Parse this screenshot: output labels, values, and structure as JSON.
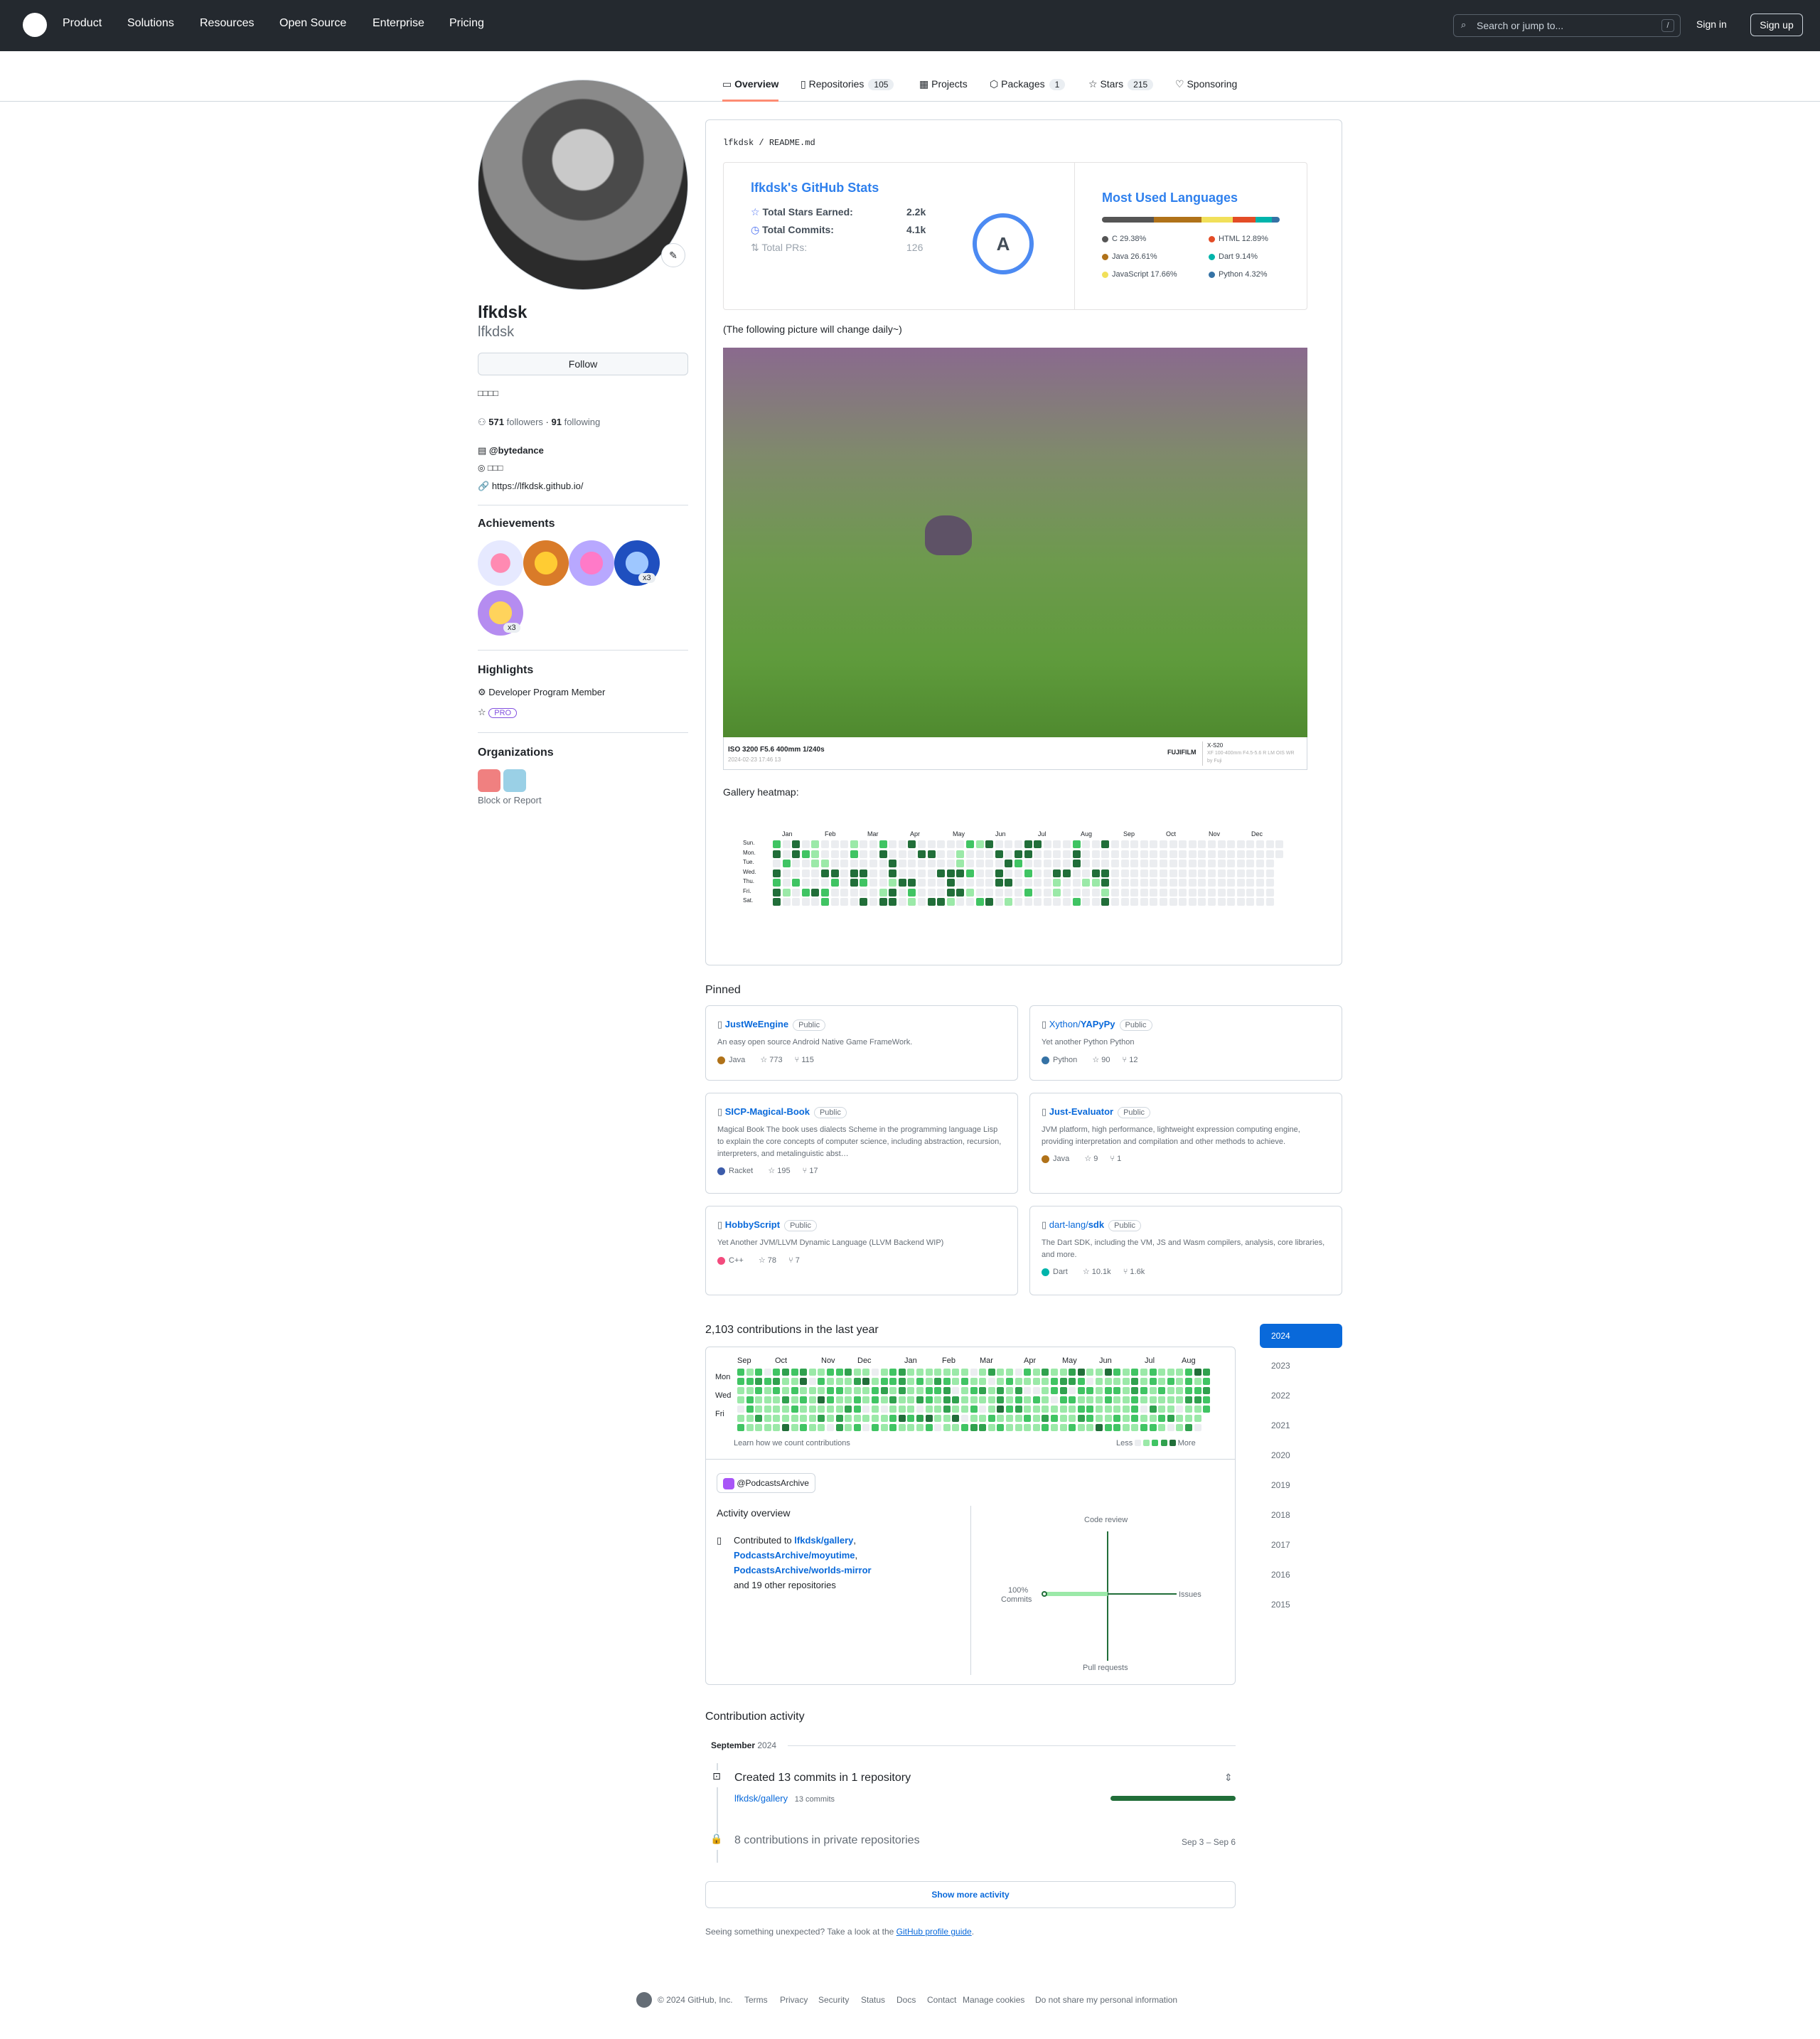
{
  "topbar": {
    "nav": [
      "Product",
      "Solutions",
      "Resources",
      "Open Source",
      "Enterprise",
      "Pricing"
    ],
    "search_placeholder": "Search or jump to...",
    "search_key": "/",
    "signin": "Sign in",
    "signup": "Sign up"
  },
  "tabs": [
    {
      "label": "Overview",
      "count": ""
    },
    {
      "label": "Repositories",
      "count": "105"
    },
    {
      "label": "Projects",
      "count": ""
    },
    {
      "label": "Packages",
      "count": "1"
    },
    {
      "label": "Stars",
      "count": "215"
    },
    {
      "label": "Sponsoring",
      "count": ""
    }
  ],
  "profile": {
    "name": "lfkdsk",
    "username": "lfkdsk",
    "follow": "Follow",
    "bio": "□□□□",
    "followers": "571",
    "followers_label": "followers",
    "following": "91",
    "following_label": "following",
    "separator": "·",
    "company": "@bytedance",
    "location": "□□□",
    "website": "https://lfkdsk.github.io/"
  },
  "achievements": {
    "title": "Achievements",
    "badge1": "x3",
    "badge2": "x3"
  },
  "highlights": {
    "title": "Highlights",
    "dev": "Developer Program Member",
    "pro": "PRO"
  },
  "organizations": {
    "title": "Organizations",
    "block": "Block or Report"
  },
  "readme": {
    "path_user": "lfkdsk",
    "path_sep": "/",
    "path_file": "README.md",
    "stats_title": "lfkdsk's GitHub Stats",
    "stats_stars_label": "Total Stars Earned:",
    "stats_stars": "2.2k",
    "stats_commits_label": "Total Commits:",
    "stats_commits": "4.1k",
    "stats_prs_label": "Total PRs:",
    "stats_prs": "126",
    "rank": "A",
    "langs_title": "Most Used Languages",
    "langs": [
      {
        "label": "C 29.38%",
        "color": "#555555",
        "pct": 29.38
      },
      {
        "label": "Java 26.61%",
        "color": "#b07219",
        "pct": 26.61
      },
      {
        "label": "JavaScript 17.66%",
        "color": "#f1e05a",
        "pct": 17.66
      },
      {
        "label": "HTML 12.89%",
        "color": "#e34c26",
        "pct": 12.89
      },
      {
        "label": "Dart 9.14%",
        "color": "#00b4ab",
        "pct": 9.14
      },
      {
        "label": "Python 4.32%",
        "color": "#3572A5",
        "pct": 4.32
      }
    ],
    "daily_note": "(The following picture will change daily~)",
    "photo_caption": "ISO 3200 F5.6 400mm 1/240s",
    "photo_brand": "FUJIFILM",
    "photo_meta": "2024-02-23 17:46 13",
    "photo_lens": "X-S20",
    "photo_lens_sub": "XF 100-400mm F4.5-5.6 R LM OIS WR",
    "photo_lens_sub2": "by Fuji",
    "gallery_label": "Gallery heatmap:",
    "gallery_months": [
      "Jan",
      "Feb",
      "Mar",
      "Apr",
      "May",
      "Jun",
      "Jul",
      "Aug",
      "Sep",
      "Oct",
      "Nov",
      "Dec"
    ],
    "gallery_days": [
      "Sun.",
      "Mon.",
      "Tue.",
      "Wed.",
      "Thu.",
      "Fri.",
      "Sat."
    ]
  },
  "pinned": {
    "title": "Pinned",
    "public": "Public",
    "repos": [
      {
        "owner": "",
        "name": "JustWeEngine",
        "desc": "An easy open source Android Native Game FrameWork.",
        "lang": "Java",
        "lang_color": "#b07219",
        "stars": "773",
        "forks": "115"
      },
      {
        "owner": "Xython/",
        "name": "YAPyPy",
        "desc": "Yet another Python Python",
        "lang": "Python",
        "lang_color": "#3572A5",
        "stars": "90",
        "forks": "12"
      },
      {
        "owner": "",
        "name": "SICP-Magical-Book",
        "desc": "Magical Book The book uses dialects Scheme in the programming language Lisp to explain the core concepts of computer science, including abstraction, recursion, interpreters, and metalinguistic abst…",
        "lang": "Racket",
        "lang_color": "#3c5caa",
        "stars": "195",
        "forks": "17"
      },
      {
        "owner": "",
        "name": "Just-Evaluator",
        "desc": "JVM platform, high performance, lightweight expression computing engine, providing interpretation and compilation and other methods to achieve.",
        "lang": "Java",
        "lang_color": "#b07219",
        "stars": "9",
        "forks": "1"
      },
      {
        "owner": "",
        "name": "HobbyScript",
        "desc": "Yet Another JVM/LLVM Dynamic Language (LLVM Backend WIP)",
        "lang": "C++",
        "lang_color": "#f34b7d",
        "stars": "78",
        "forks": "7"
      },
      {
        "owner": "dart-lang/",
        "name": "sdk",
        "desc": "The Dart SDK, including the VM, JS and Wasm compilers, analysis, core libraries, and more.",
        "lang": "Dart",
        "lang_color": "#00B4AB",
        "stars": "10.1k",
        "forks": "1.6k"
      }
    ]
  },
  "contrib": {
    "title": "2,103 contributions in the last year",
    "months": [
      "Sep",
      "Oct",
      "Nov",
      "Dec",
      "Jan",
      "Feb",
      "Mar",
      "Apr",
      "May",
      "Jun",
      "Jul",
      "Aug"
    ],
    "days": [
      "Mon",
      "Wed",
      "Fri"
    ],
    "learn": "Learn how we count contributions",
    "less": "Less",
    "more": "More",
    "org": "@PodcastsArchive",
    "overview_title": "Activity overview",
    "contributed_to": "Contributed to",
    "repo1": "lfkdsk/gallery",
    "repo2": "PodcastsArchive/moyutime",
    "repo3": "PodcastsArchive/worlds-mirror",
    "comma": ",",
    "others": "and 19 other repositories",
    "axis_top": "Code review",
    "axis_left_pct": "100%",
    "axis_left": "Commits",
    "axis_right": "Issues",
    "axis_bottom": "Pull requests",
    "commits_fraction": 1.0,
    "years": [
      "2024",
      "2023",
      "2022",
      "2021",
      "2020",
      "2019",
      "2018",
      "2017",
      "2016",
      "2015"
    ]
  },
  "activity": {
    "title": "Contribution activity",
    "month": "September",
    "year": "2024",
    "created": "Created 13 commits in 1 repository",
    "repo": "lfkdsk/gallery",
    "repo_commits": "13 commits",
    "private": "8 contributions in private repositories",
    "range": "Sep 3 – Sep 6",
    "show_more": "Show more activity",
    "unexpected": "Seeing something unexpected? Take a look at the",
    "guide": "GitHub profile guide",
    "period": "."
  },
  "footer": {
    "copyright": "© 2024 GitHub, Inc.",
    "links": [
      "Terms",
      "Privacy",
      "Security",
      "Status",
      "Docs",
      "Contact",
      "Manage cookies",
      "Do not share my personal information"
    ]
  },
  "colors": {
    "accent": "#0969da",
    "green1": "#9be9a8",
    "green2": "#40c463",
    "green3": "#30a14e",
    "green4": "#216e39",
    "empty": "#ebedf0"
  }
}
